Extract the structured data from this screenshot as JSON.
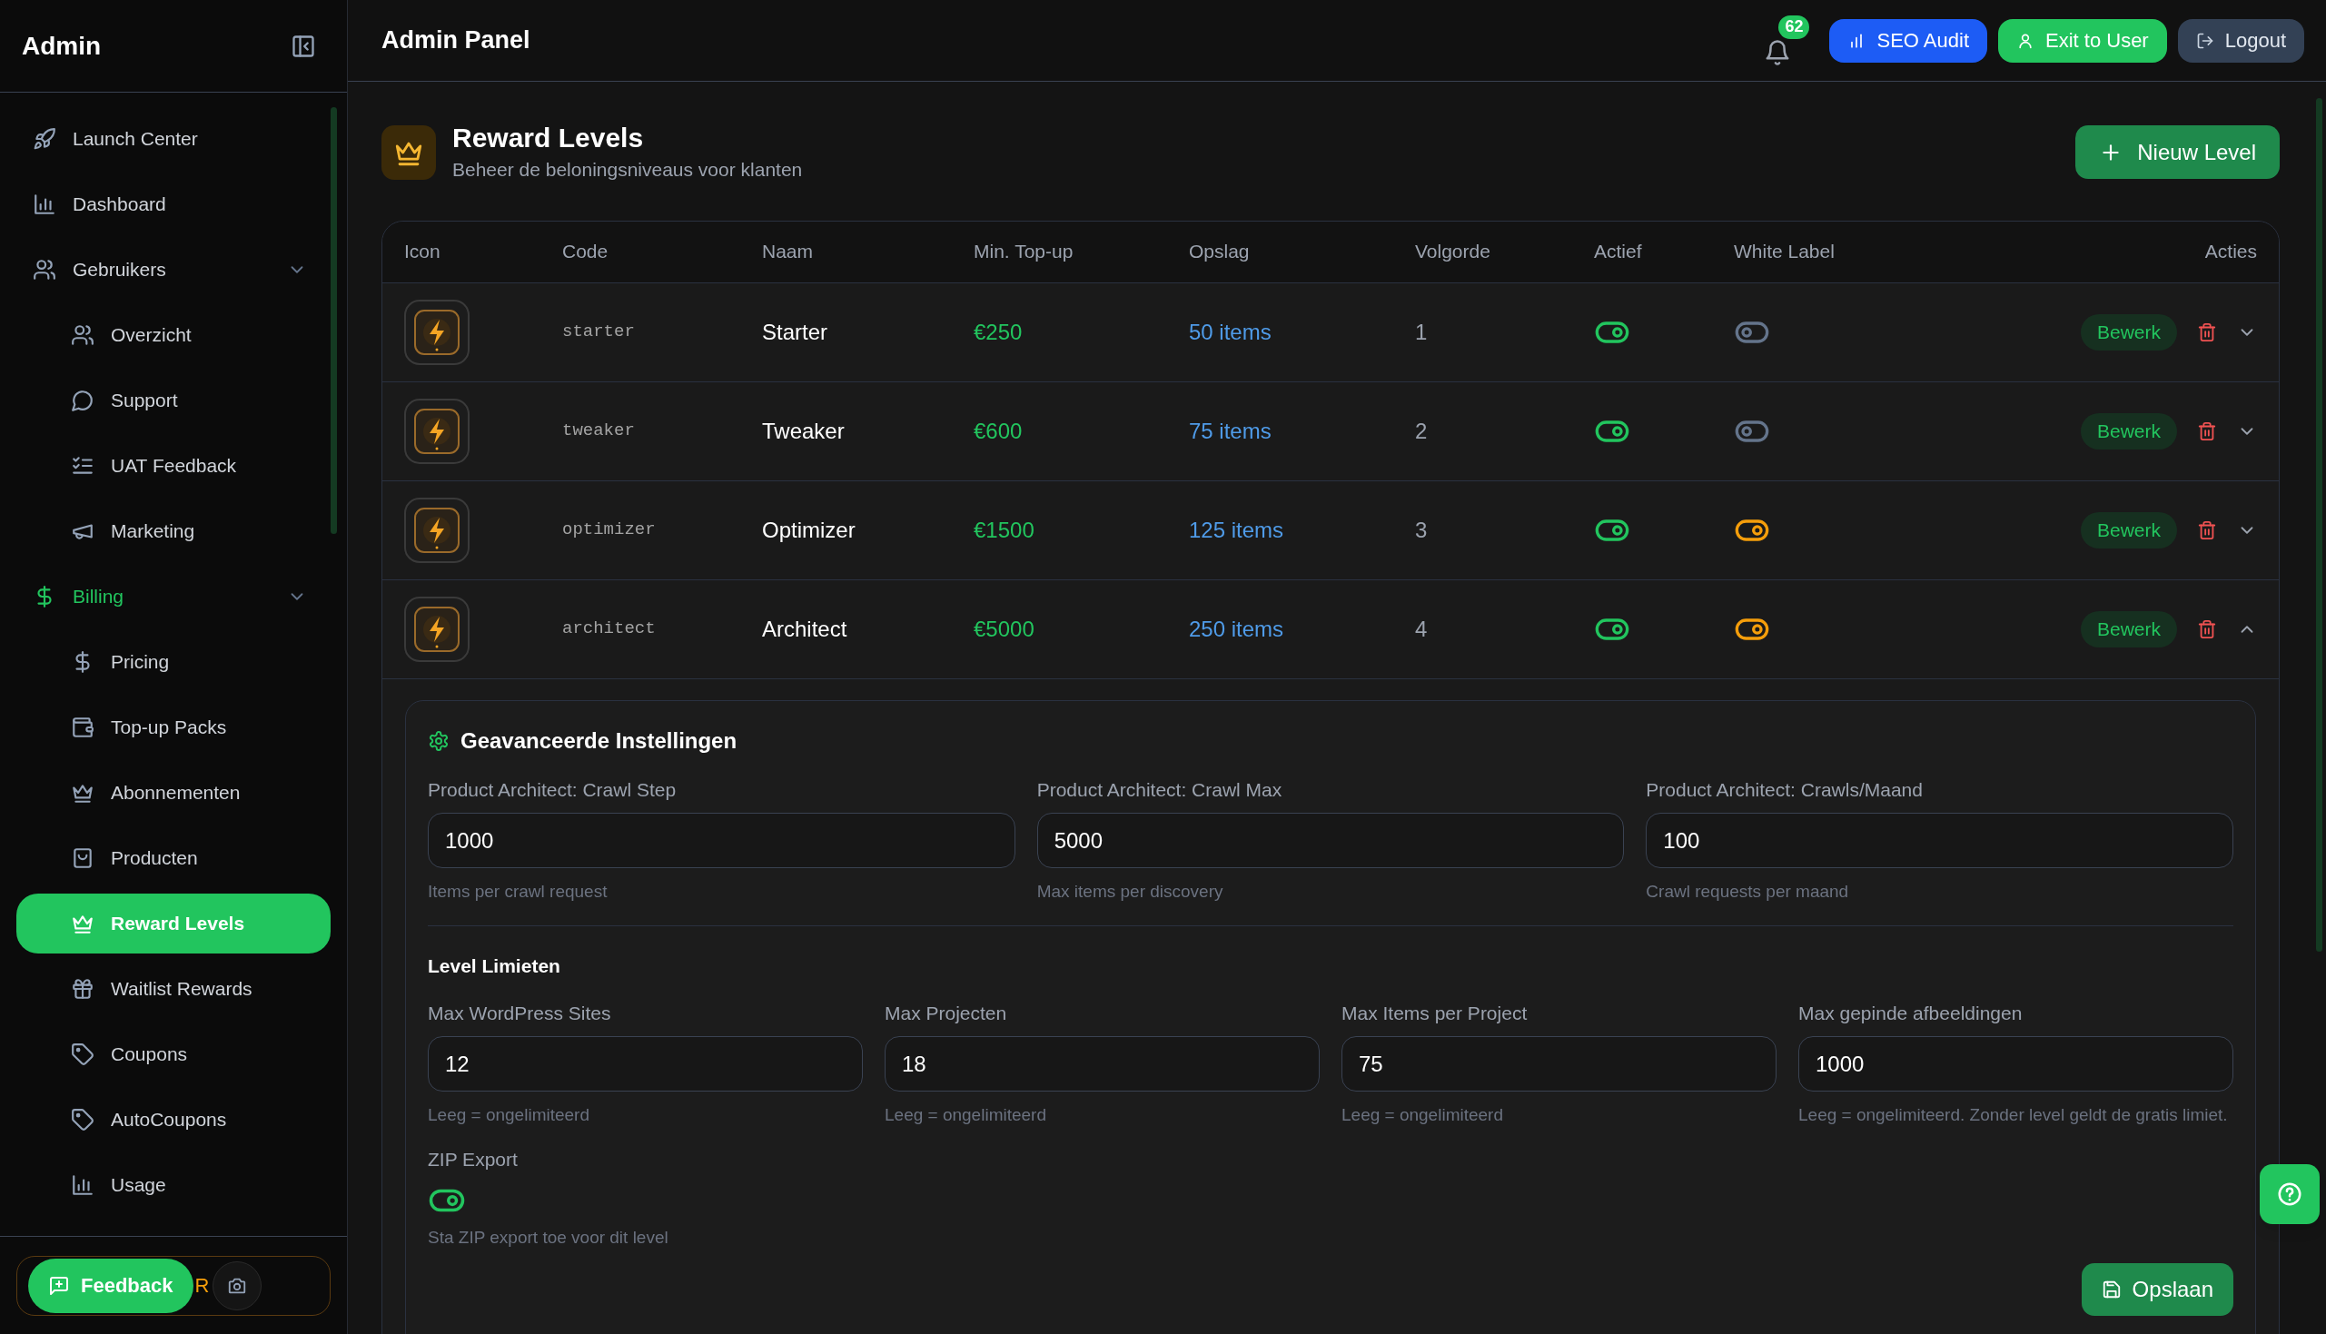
{
  "sidebar": {
    "title": "Admin",
    "items": [
      {
        "label": "Launch Center",
        "selected": false
      },
      {
        "label": "Dashboard",
        "selected": false
      },
      {
        "label": "Gebruikers",
        "selected": false,
        "expanded": true,
        "children": [
          {
            "label": "Overzicht",
            "selected": false
          },
          {
            "label": "Support",
            "selected": false
          },
          {
            "label": "UAT Feedback",
            "selected": false
          },
          {
            "label": "Marketing",
            "selected": false
          }
        ]
      },
      {
        "label": "Billing",
        "selected": false,
        "expanded": true,
        "children": [
          {
            "label": "Pricing",
            "selected": false
          },
          {
            "label": "Top-up Packs",
            "selected": false
          },
          {
            "label": "Abonnementen",
            "selected": false
          },
          {
            "label": "Producten",
            "selected": false
          },
          {
            "label": "Reward Levels",
            "selected": true
          },
          {
            "label": "Waitlist Rewards",
            "selected": false
          },
          {
            "label": "Coupons",
            "selected": false
          },
          {
            "label": "AutoCoupons",
            "selected": false
          },
          {
            "label": "Usage",
            "selected": false
          }
        ]
      }
    ],
    "feedback": {
      "button": "Feedback",
      "behind": "R"
    }
  },
  "header": {
    "title": "Admin Panel",
    "notifications": "62",
    "buttons": [
      {
        "label": "SEO Audit",
        "kind": "seo"
      },
      {
        "label": "Exit to User",
        "kind": "exit"
      },
      {
        "label": "Logout",
        "kind": "logout"
      }
    ]
  },
  "page": {
    "title": "Reward Levels",
    "subtitle": "Beheer de beloningsniveaus voor klanten",
    "new_button": "Nieuw Level"
  },
  "table": {
    "columns": [
      "Icon",
      "Code",
      "Naam",
      "Min. Top-up",
      "Opslag",
      "Volgorde",
      "Actief",
      "White Label",
      "Acties"
    ],
    "rows": [
      {
        "code": "starter",
        "name": "Starter",
        "min_topup": "€250",
        "storage": "50 items",
        "order": "1",
        "active": true,
        "white_label": false,
        "action": "Bewerk",
        "expanded": false
      },
      {
        "code": "tweaker",
        "name": "Tweaker",
        "min_topup": "€600",
        "storage": "75 items",
        "order": "2",
        "active": true,
        "white_label": false,
        "action": "Bewerk",
        "expanded": false
      },
      {
        "code": "optimizer",
        "name": "Optimizer",
        "min_topup": "€1500",
        "storage": "125 items",
        "order": "3",
        "active": true,
        "white_label": true,
        "action": "Bewerk",
        "expanded": false
      },
      {
        "code": "architect",
        "name": "Architect",
        "min_topup": "€5000",
        "storage": "250 items",
        "order": "4",
        "active": true,
        "white_label": true,
        "action": "Bewerk",
        "expanded": true
      }
    ]
  },
  "details": {
    "title": "Geavanceerde Instellingen",
    "fields": [
      {
        "label": "Product Architect: Crawl Step",
        "value": "1000",
        "hint": "Items per crawl request"
      },
      {
        "label": "Product Architect: Crawl Max",
        "value": "5000",
        "hint": "Max items per discovery"
      },
      {
        "label": "Product Architect: Crawls/Maand",
        "value": "100",
        "hint": "Crawl requests per maand"
      }
    ],
    "limits_title": "Level Limieten",
    "limits": [
      {
        "label": "Max WordPress Sites",
        "value": "12",
        "hint": "Leeg = ongelimiteerd"
      },
      {
        "label": "Max Projecten",
        "value": "18",
        "hint": "Leeg = ongelimiteerd"
      },
      {
        "label": "Max Items per Project",
        "value": "75",
        "hint": "Leeg = ongelimiteerd"
      },
      {
        "label": "Max gepinde afbeeldingen",
        "value": "1000",
        "hint": "Leeg = ongelimiteerd. Zonder level geldt de gratis limiet."
      }
    ],
    "zip_export": {
      "label": "ZIP Export",
      "on": true,
      "hint": "Sta ZIP export toe voor dit level"
    },
    "save": "Opslaan"
  }
}
